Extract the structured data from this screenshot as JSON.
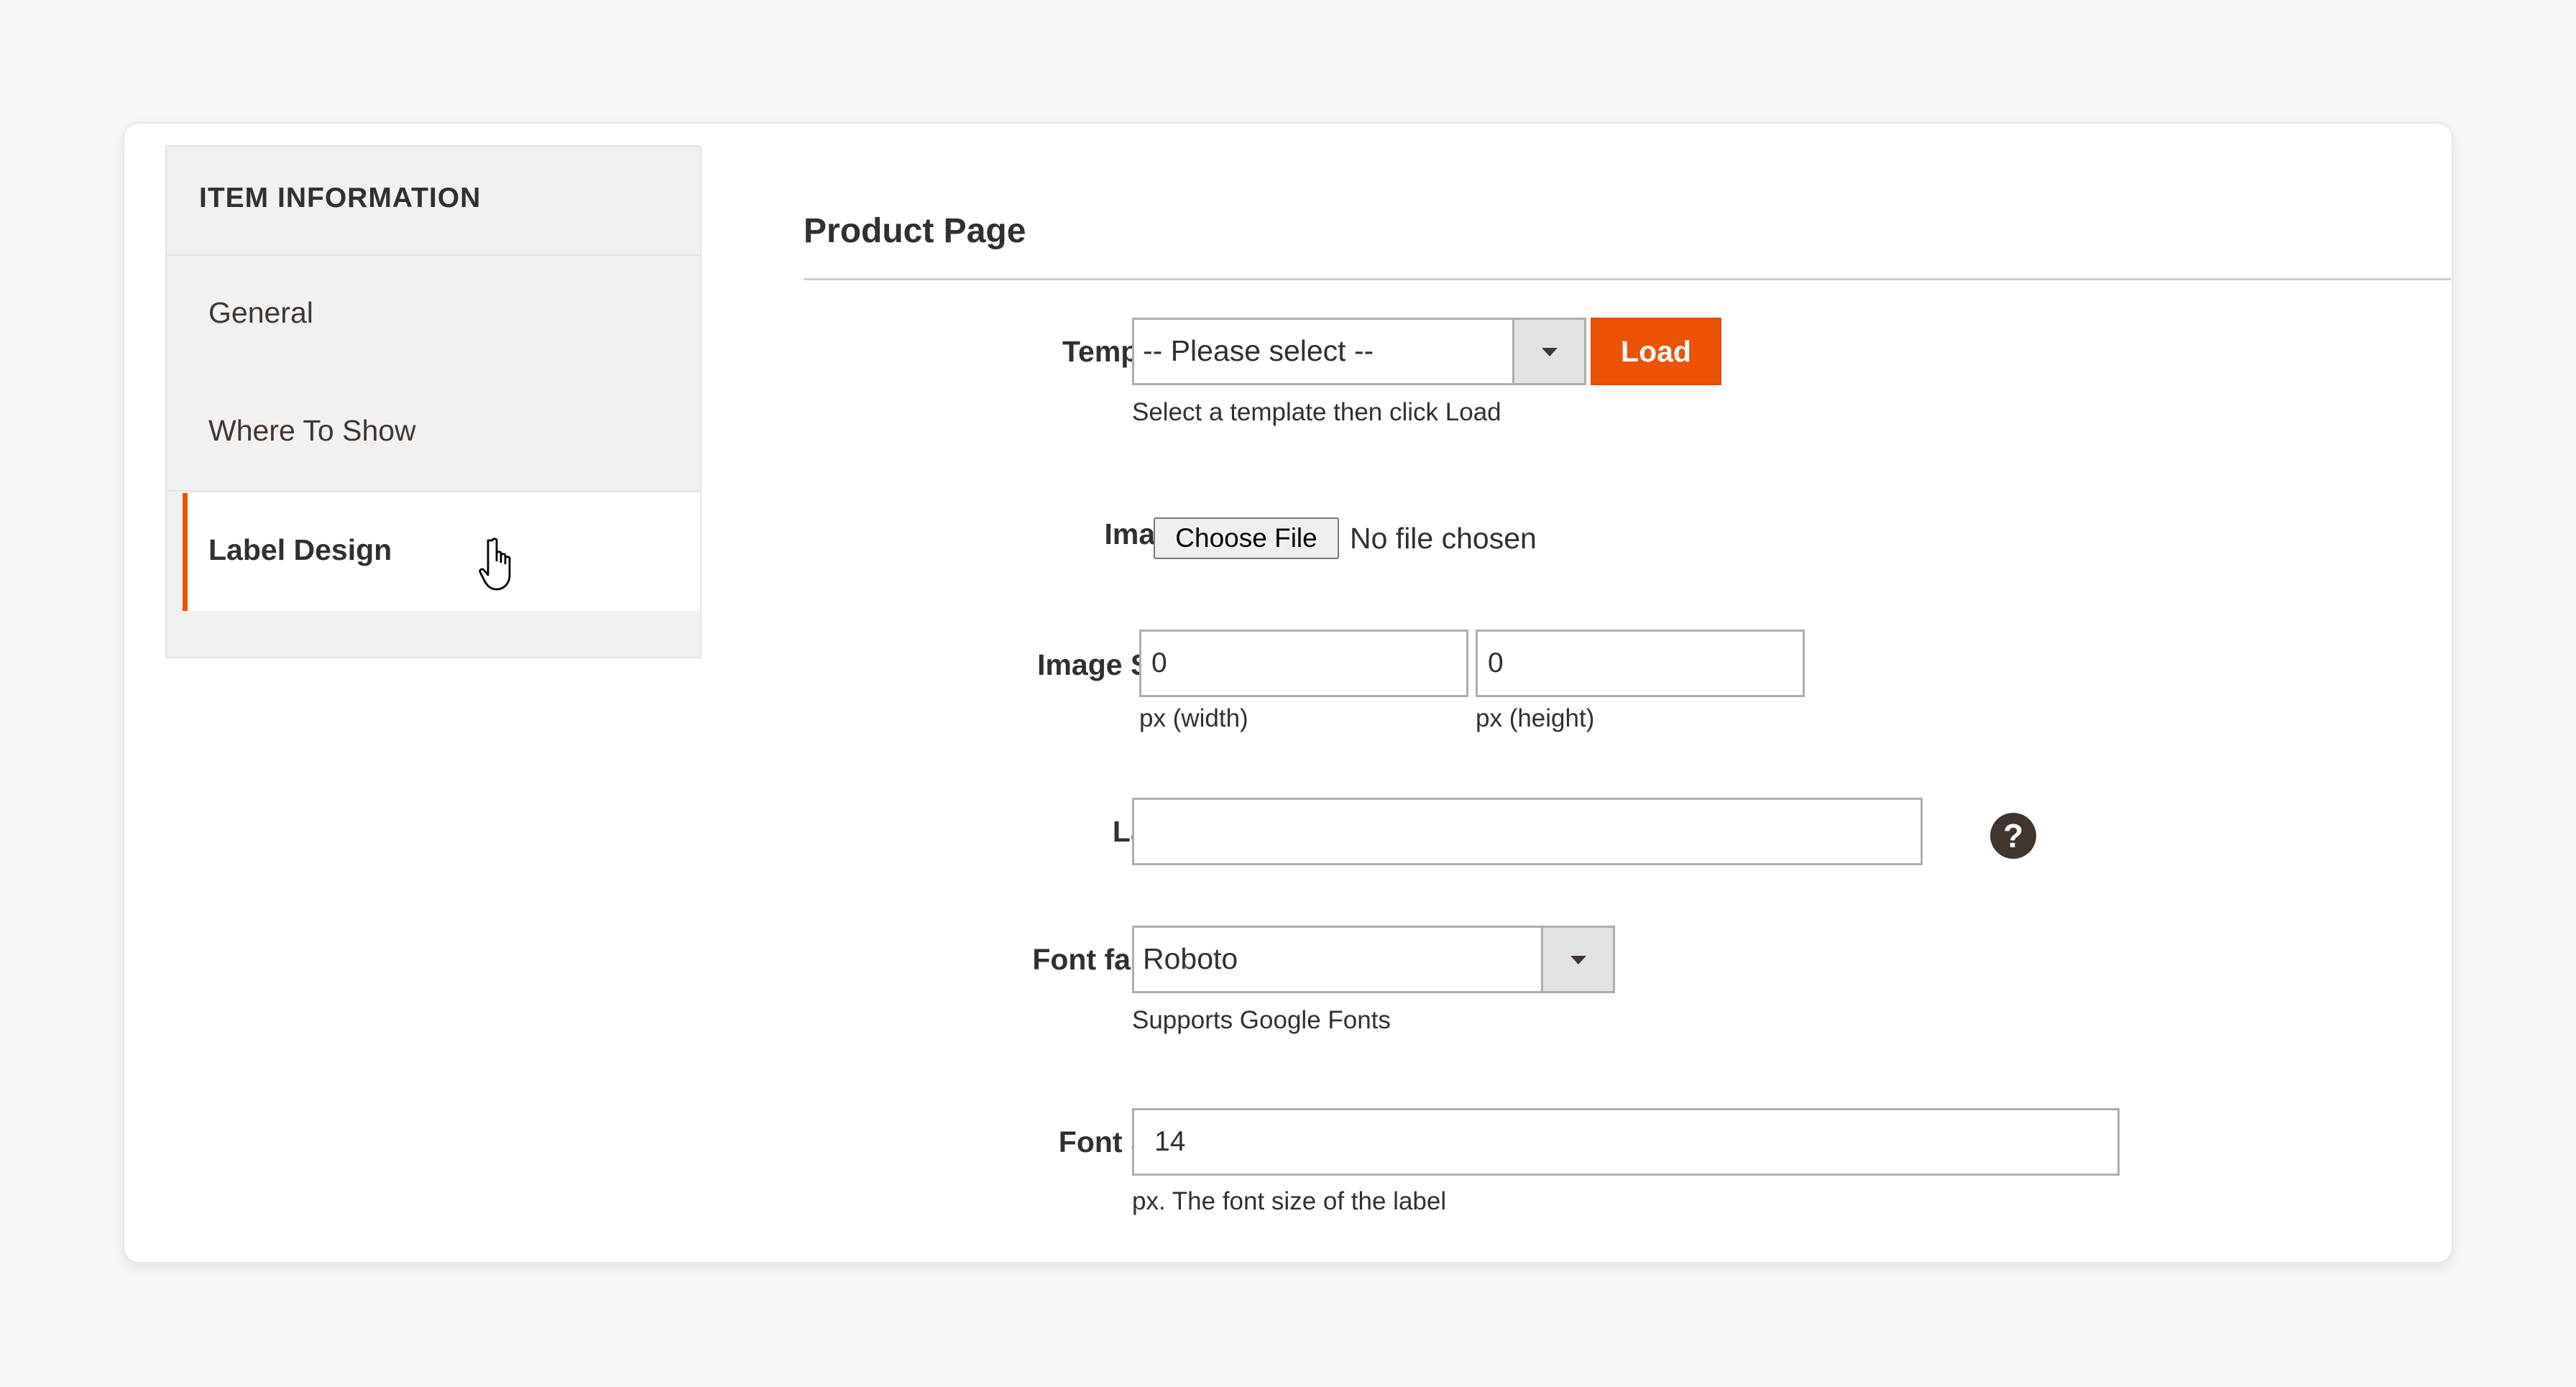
{
  "sidebar": {
    "header": "ITEM INFORMATION",
    "items": [
      {
        "label": "General",
        "active": false
      },
      {
        "label": "Where To Show",
        "active": false
      },
      {
        "label": "Label Design",
        "active": true
      }
    ]
  },
  "section": {
    "title": "Product Page"
  },
  "template": {
    "label": "Template",
    "selected": "-- Please select --",
    "load_label": "Load",
    "note": "Select a template then click Load"
  },
  "image": {
    "label": "Image",
    "button_label": "Choose File",
    "status": "No file chosen"
  },
  "image_size": {
    "label": "Image Size",
    "width_value": "0",
    "width_note": "px (width)",
    "height_value": "0",
    "height_note": "px (height)"
  },
  "label_field": {
    "label": "Label",
    "value": "",
    "help_icon": "question-circle-icon",
    "help_glyph": "?"
  },
  "font_family": {
    "label": "Font family",
    "selected": "Roboto",
    "note": "Supports Google Fonts"
  },
  "font_size": {
    "label": "Font Size",
    "value": "14",
    "note": "px. The font size of the label"
  },
  "colors": {
    "accent": "#eb5202",
    "background": "#f7f7f7",
    "sidebar_bg": "#f1f1f1"
  }
}
